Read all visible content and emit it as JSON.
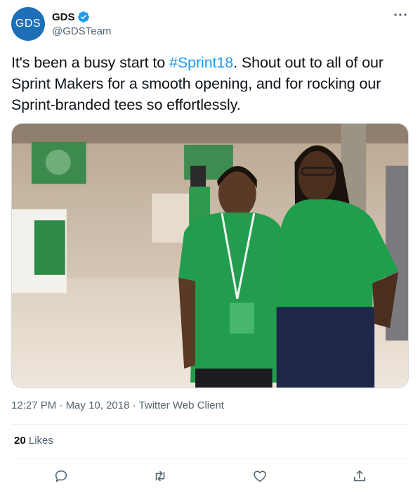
{
  "author": {
    "avatar_text": "GDS",
    "display_name": "GDS",
    "handle": "@GDSTeam",
    "verified": true
  },
  "tweet": {
    "text_before": "It's been a busy start to ",
    "hashtag": "#Sprint18",
    "text_after": ". Shout out to all of our Sprint Makers for a smooth opening, and for rocking our Sprint-branded tees so effortlessly."
  },
  "meta": {
    "time": "12:27 PM",
    "separator": "·",
    "date": "May 10, 2018",
    "client": "Twitter Web Client"
  },
  "stats": {
    "likes_count": "20",
    "likes_label": "Likes"
  },
  "actions": {
    "reply_icon": "reply-icon",
    "retweet_icon": "retweet-icon",
    "like_icon": "heart-icon",
    "share_icon": "share-icon"
  },
  "colors": {
    "accent": "#1d9bf0",
    "avatar_bg": "#1d6fb8",
    "secondary_text": "#536471",
    "shirt_green": "#1f9e4c"
  }
}
